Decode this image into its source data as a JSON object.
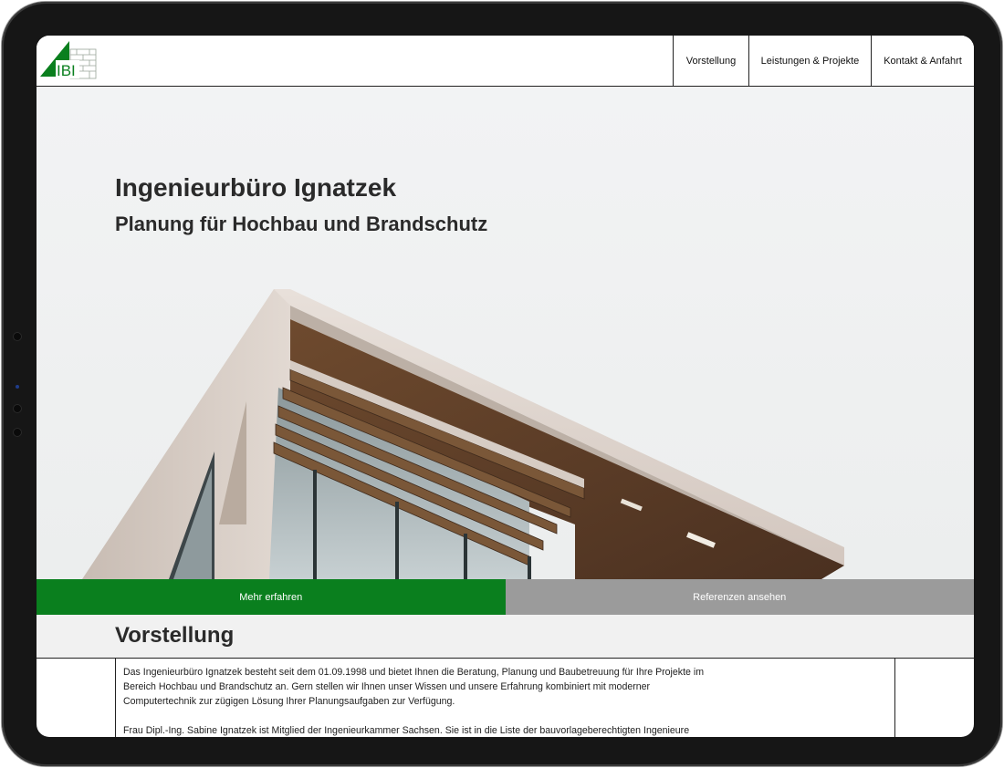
{
  "logo": {
    "text": "IBI"
  },
  "nav": {
    "items": [
      {
        "label": "Vorstellung"
      },
      {
        "label": "Leistungen & Projekte"
      },
      {
        "label": "Kontakt & Anfahrt"
      }
    ]
  },
  "hero": {
    "title": "Ingenieurbüro Ignatzek",
    "subtitle": "Planung für Hochbau und Brandschutz"
  },
  "cta": {
    "primary_label": "Mehr erfahren",
    "secondary_label": "Referenzen ansehen"
  },
  "section": {
    "title": "Vorstellung",
    "paragraph1": "Das Ingenieurbüro Ignatzek besteht seit dem 01.09.1998 und bietet Ihnen die Beratung, Planung und Baubetreuung für Ihre Projekte im Bereich Hochbau und Brandschutz an. Gern stellen wir Ihnen unser Wissen und unsere Erfahrung kombiniert mit moderner Computertechnik zur zügigen Lösung Ihrer Planungsaufgaben zur Verfügung.",
    "paragraph2": "Frau Dipl.-Ing. Sabine Ignatzek ist Mitglied der Ingenieurkammer Sachsen. Sie ist in die Liste der bauvorlageberechtigten Ingenieure"
  },
  "colors": {
    "brand_green": "#0a7f1e",
    "secondary_gray": "#9b9b9b",
    "text_dark": "#2a2a2a"
  }
}
